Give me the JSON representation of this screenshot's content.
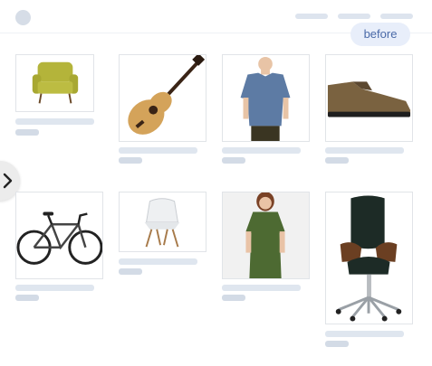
{
  "header": {
    "badge_label": "before"
  },
  "products": [
    {
      "icon": "armchair-icon"
    },
    {
      "icon": "guitar-icon"
    },
    {
      "icon": "tshirt-icon"
    },
    {
      "icon": "shoe-icon"
    },
    {
      "icon": "bicycle-icon"
    },
    {
      "icon": "plastic-chair-icon"
    },
    {
      "icon": "dress-icon"
    },
    {
      "icon": "office-chair-icon"
    }
  ],
  "colors": {
    "accent": "#4a6aa8",
    "placeholder": "#dfe6ef",
    "badge_bg": "#e8eefa"
  }
}
